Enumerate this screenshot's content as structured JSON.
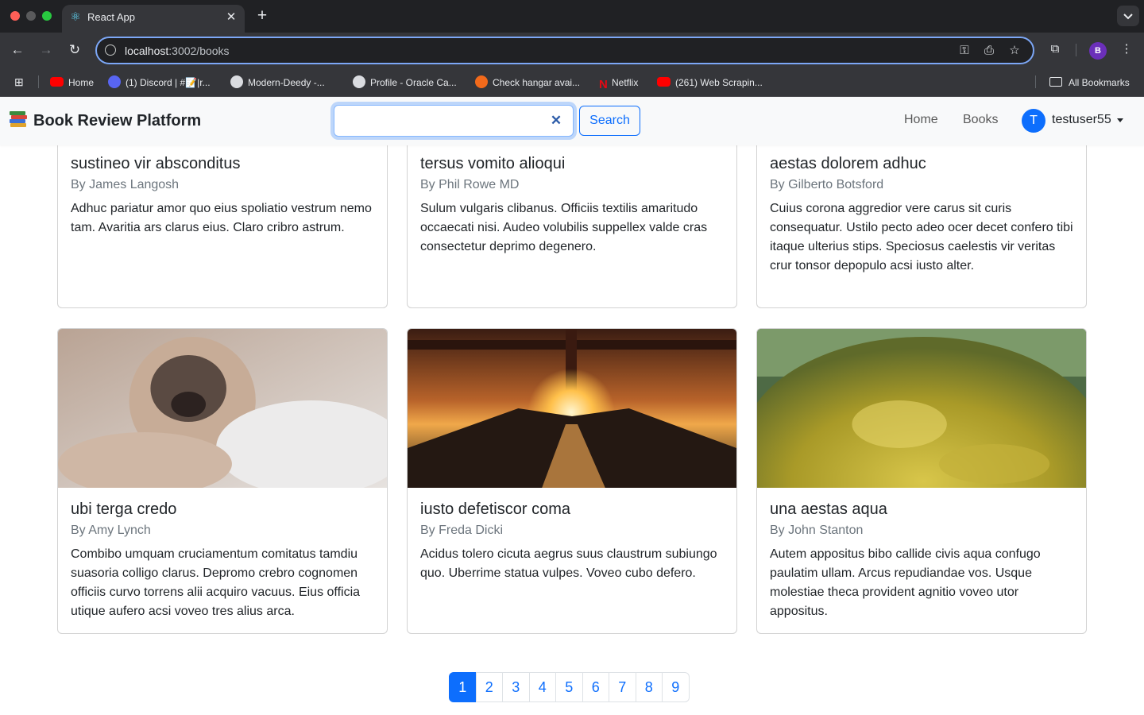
{
  "browser": {
    "tab_title": "React App",
    "url_host": "localhost",
    "url_rest": ":3002/books",
    "profile_initial": "B",
    "bookmarks": [
      {
        "label": "Home",
        "icon": "youtube-icon"
      },
      {
        "label": "(1) Discord | #📝|r...",
        "icon": "discord-icon"
      },
      {
        "label": "Modern-Deedy -...",
        "icon": "overleaf-icon"
      },
      {
        "label": "Profile - Oracle Ca...",
        "icon": "globe-icon"
      },
      {
        "label": "Check hangar avai...",
        "icon": "hangar-icon"
      },
      {
        "label": "Netflix",
        "icon": "netflix-icon"
      },
      {
        "label": "(261) Web Scrapin...",
        "icon": "youtube-icon"
      }
    ],
    "all_bookmarks": "All Bookmarks"
  },
  "app": {
    "brand": "Book Review Platform",
    "search": {
      "value": "",
      "button": "Search"
    },
    "nav": {
      "home": "Home",
      "books": "Books"
    },
    "user": {
      "initial": "T",
      "name": "testuser55"
    }
  },
  "books": [
    {
      "title": "sustineo vir absconditus",
      "author": "By James Langosh",
      "description": "Adhuc pariatur amor quo eius spoliatio vestrum nemo tam. Avaritia ars clarus eius. Claro cribro astrum."
    },
    {
      "title": "tersus vomito alioqui",
      "author": "By Phil Rowe MD",
      "description": "Sulum vulgaris clibanus. Officiis textilis amaritudo occaecati nisi. Audeo volubilis suppellex valde cras consectetur deprimo degenero."
    },
    {
      "title": "aestas dolorem adhuc",
      "author": "By Gilberto Botsford",
      "description": "Cuius corona aggredior vere carus sit curis consequatur. Ustilo pecto adeo ocer decet confero tibi itaque ulterius stips. Speciosus caelestis vir veritas crur tonsor depopulo acsi iusto alter."
    },
    {
      "title": "ubi terga credo",
      "author": "By Amy Lynch",
      "description": "Combibo umquam cruciamentum comitatus tamdiu suasoria colligo clarus. Depromo crebro cognomen officiis curvo torrens alii acquiro vacuus. Eius officia utique aufero acsi voveo tres alius arca."
    },
    {
      "title": "iusto defetiscor coma",
      "author": "By Freda Dicki",
      "description": "Acidus tolero cicuta aegrus suus claustrum subiungo quo. Uberrime statua vulpes. Voveo cubo defero."
    },
    {
      "title": "una aestas aqua",
      "author": "By John Stanton",
      "description": "Autem appositus bibo callide civis aqua confugo paulatim ullam. Arcus repudiandae vos. Usque molestiae theca provident agnitio voveo utor appositus."
    }
  ],
  "pagination": {
    "pages": [
      "1",
      "2",
      "3",
      "4",
      "5",
      "6",
      "7",
      "8",
      "9"
    ],
    "active": "1"
  }
}
